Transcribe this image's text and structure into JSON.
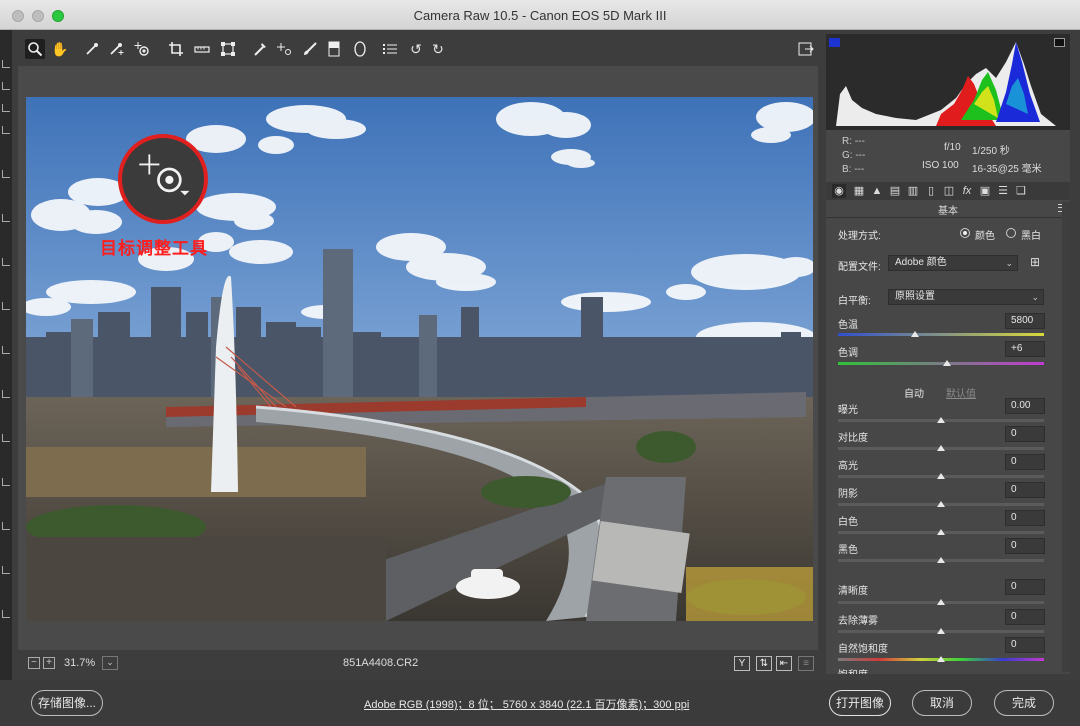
{
  "window": {
    "title": "Camera Raw 10.5  -  Canon EOS 5D Mark III"
  },
  "toolbar": {
    "tools": [
      "zoom-icon",
      "hand-icon",
      "white-balance-icon",
      "color-sampler-icon",
      "targeted-adjustment-icon",
      "crop-icon",
      "straighten-icon",
      "transform-icon",
      "spot-removal-icon",
      "red-eye-icon",
      "adjustment-brush-icon",
      "graduated-filter-icon",
      "radial-filter-icon",
      "preferences-icon",
      "rotate-left-icon",
      "rotate-right-icon"
    ],
    "export_icon": "fullscreen-icon"
  },
  "callout": {
    "label": "目标调整工具"
  },
  "bottombar": {
    "zoom_minus": "−",
    "zoom_plus": "+",
    "zoom_level": "31.7%",
    "zoom_dropdown": "⌄",
    "filename": "851A4408.CR2",
    "icon_y": "Y",
    "icon_compare": "⇅",
    "icon_swap": "⇤"
  },
  "footer": {
    "save_label": "存储图像...",
    "workflow": "Adobe RGB (1998)；8 位；  5760 x 3840 (22.1 百万像素)；300 ppi",
    "open_label": "打开图像",
    "cancel_label": "取消",
    "done_label": "完成"
  },
  "info": {
    "r": "R:   ---",
    "g": "G:   ---",
    "b": "B:   ---",
    "aperture": "f/10",
    "shutter": "1/250 秒",
    "iso": "ISO 100",
    "lens": "16-35@25 毫米"
  },
  "panel": {
    "section_title": "基本",
    "treatment_label": "处理方式:",
    "treatment_color": "颜色",
    "treatment_bw": "黑白",
    "profile_label": "配置文件:",
    "profile_value": "Adobe 颜色",
    "wb_label": "白平衡:",
    "wb_value": "原照设置",
    "temp_label": "色温",
    "temp_value": "5800",
    "tint_label": "色调",
    "tint_value": "+6",
    "auto_label": "自动",
    "default_label": "默认值",
    "sliders": [
      {
        "label": "曝光",
        "value": "0.00"
      },
      {
        "label": "对比度",
        "value": "0"
      },
      {
        "label": "高光",
        "value": "0"
      },
      {
        "label": "阴影",
        "value": "0"
      },
      {
        "label": "白色",
        "value": "0"
      },
      {
        "label": "黑色",
        "value": "0"
      },
      {
        "label": "清晰度",
        "value": "0"
      },
      {
        "label": "去除薄雾",
        "value": "0"
      },
      {
        "label": "自然饱和度",
        "value": "0"
      },
      {
        "label": "饱和度",
        "value": ""
      }
    ]
  },
  "colors": {
    "accent_red": "#e0201e",
    "panel_bg": "#474747"
  }
}
